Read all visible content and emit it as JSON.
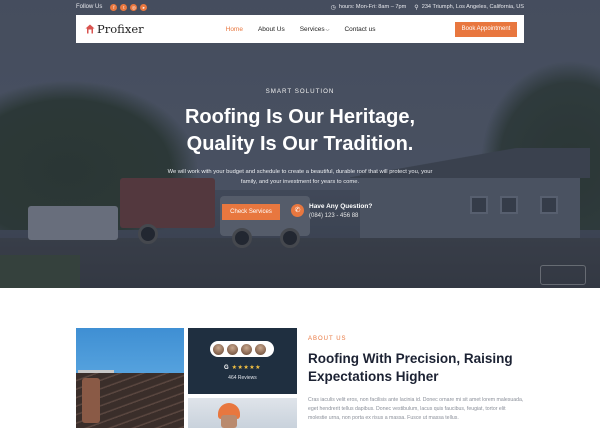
{
  "topbar": {
    "follow_label": "Follow Us",
    "social_icons": [
      "facebook-icon",
      "twitter-icon",
      "instagram-icon",
      "youtube-icon"
    ],
    "hours": "hours: Mon-Fri: 8am – 7pm",
    "address": "234 Triumph, Los Angeles, California, US"
  },
  "navbar": {
    "logo_text": "Profixer",
    "menu": [
      {
        "label": "Home",
        "active": true
      },
      {
        "label": "About Us",
        "active": false
      },
      {
        "label": "Services",
        "active": false,
        "has_dropdown": true
      },
      {
        "label": "Contact us",
        "active": false
      }
    ],
    "cta_label": "Book Appointment"
  },
  "hero": {
    "eyebrow": "SMART SOLUTION",
    "headline_line1": "Roofing Is Our Heritage,",
    "headline_line2": "Quality Is Our Tradition.",
    "subtext": "We will work with your budget and schedule to create a beautiful, durable roof that will protect you, your family, and your investment for years to come.",
    "primary_button": "Check Services",
    "question": "Have Any Question?",
    "phone": "(084) 123 - 456 88"
  },
  "review_card": {
    "rating_icon": "google-icon",
    "stars": "★★★★★",
    "reviews_label": "464 Reviews"
  },
  "about": {
    "eyebrow": "ABOUT US",
    "title": "Roofing With Precision, Raising Expectations Higher",
    "body": "Cras iaculis velit eros, non facilisis ante lacinia id. Donec ornare mi sit amet lorem malesuada, eget hendrerit tellus dapibus. Donec vestibulum, lacus quis faucibus, feugiat, tortor elit molestie urna, non porta ex risus a massa. Fusce ut massa tellus."
  },
  "colors": {
    "accent": "#e8773f",
    "dark_card": "#1f2f40",
    "heading": "#1c2233"
  }
}
